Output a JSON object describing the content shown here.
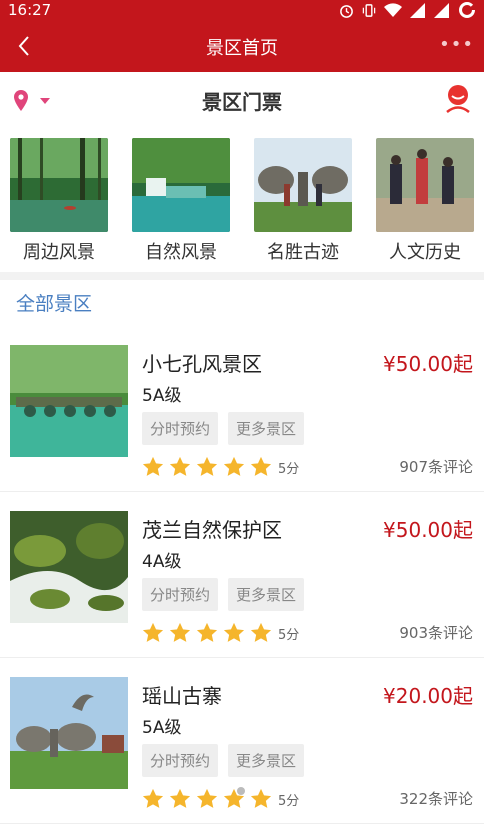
{
  "status": {
    "time": "16:27"
  },
  "nav": {
    "title": "景区首页",
    "more_label": "•••"
  },
  "sub": {
    "title": "景区门票"
  },
  "categories": [
    {
      "label": "周边风景"
    },
    {
      "label": "自然风景"
    },
    {
      "label": "名胜古迹"
    },
    {
      "label": "人文历史"
    }
  ],
  "section": {
    "title": "全部景区"
  },
  "items": [
    {
      "name": "小七孔风景区",
      "price": "¥50.00起",
      "grade": "5A级",
      "tag1": "分时预约",
      "tag2": "更多景区",
      "score": "5分",
      "reviews": "907条评论",
      "rating": 5
    },
    {
      "name": "茂兰自然保护区",
      "price": "¥50.00起",
      "grade": "4A级",
      "tag1": "分时预约",
      "tag2": "更多景区",
      "score": "5分",
      "reviews": "903条评论",
      "rating": 5
    },
    {
      "name": "瑶山古寨",
      "price": "¥20.00起",
      "grade": "5A级",
      "tag1": "分时预约",
      "tag2": "更多景区",
      "score": "5分",
      "reviews": "322条评论",
      "rating": 5
    }
  ],
  "colors": {
    "brand": "#c3161c",
    "link": "#4a7fc1",
    "star": "#f5b52c"
  }
}
